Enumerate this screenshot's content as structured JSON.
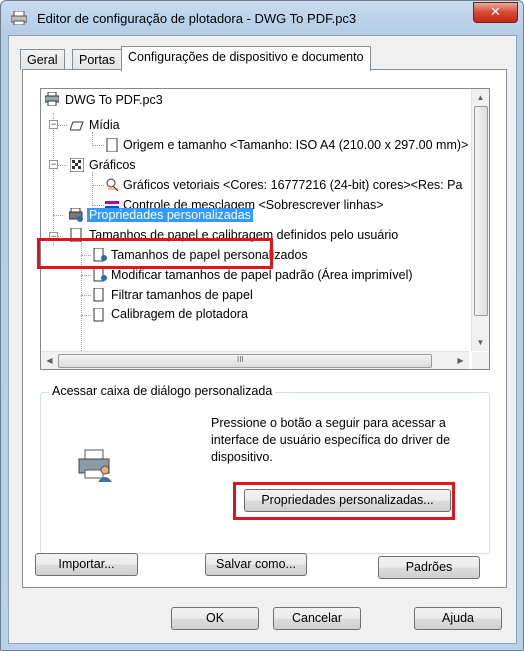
{
  "window": {
    "title": "Editor de configuração de plotadora - DWG To PDF.pc3",
    "close_label": "✕"
  },
  "tabs": [
    {
      "label": "Geral",
      "active": false
    },
    {
      "label": "Portas",
      "active": false
    },
    {
      "label": "Configurações de dispositivo e documento",
      "active": true
    }
  ],
  "tree": {
    "root": "DWG To PDF.pc3",
    "media": "Mídia",
    "media_size": "Origem e tamanho <Tamanho: ISO A4 (210.00 x 297.00 mm)>",
    "graphics": "Gráficos",
    "vector_graphics": "Gráficos vetoriais <Cores: 16777216  (24-bit) cores><Res: Pa",
    "merge_control": "Controle de mesclagem <Sobrescrever linhas>",
    "custom_props": "Propriedades personalizadas",
    "paper_sizes": "Tamanhos de papel e calibragem definidos pelo usuário",
    "custom_paper": "Tamanhos de papel personalizados",
    "modify_paper": "Modificar tamanhos de papel padrão (Área imprimível)",
    "filter_paper": "Filtrar tamanhos de papel",
    "calibration": "Calibragem de plotadora"
  },
  "scrollbar_grip": "III",
  "custom_group": {
    "legend": "Acessar caixa de diálogo personalizada",
    "description": "Pressione o botão a seguir para acessar a interface de usuário específica do driver de dispositivo.",
    "button_label": "Propriedades personalizadas..."
  },
  "buttons": {
    "import": "Importar...",
    "save_as": "Salvar como...",
    "defaults": "Padrões",
    "ok": "OK",
    "cancel": "Cancelar",
    "help": "Ajuda"
  },
  "colors": {
    "highlight_border": "#e0141c",
    "selection": "#3399ff"
  }
}
